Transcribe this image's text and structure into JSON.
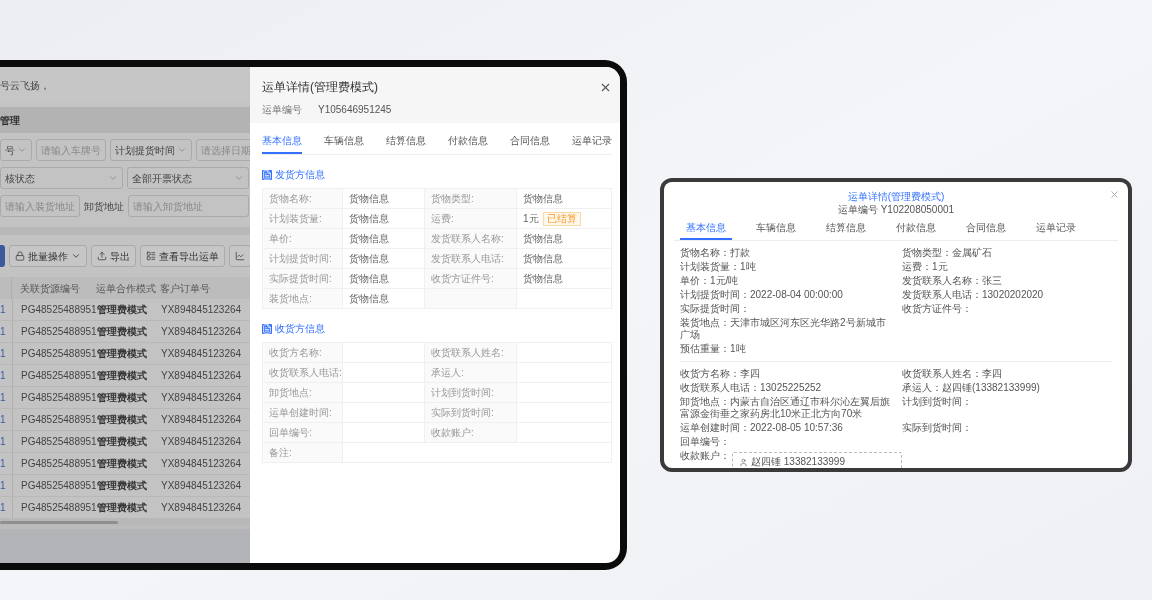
{
  "left_device": {
    "page": {
      "greeting": "号云飞扬，",
      "section_title": "管理",
      "filter_rows": [
        [
          {
            "kind": "select",
            "value": "号"
          },
          {
            "kind": "input",
            "placeholder": "请输入车牌号"
          },
          {
            "kind": "select",
            "value": "计划提货时间"
          },
          {
            "kind": "input",
            "placeholder": "请选择日期"
          }
        ],
        [
          {
            "kind": "select",
            "value": "核状态"
          },
          {
            "kind": "select",
            "value": "全部开票状态"
          }
        ],
        [
          {
            "kind": "input",
            "placeholder": "请输入装货地址"
          },
          {
            "kind": "label",
            "value": "卸货地址"
          },
          {
            "kind": "input",
            "placeholder": "请输入卸货地址"
          }
        ]
      ],
      "toolbar": [
        {
          "kind": "primary"
        },
        {
          "kind": "batch",
          "label": "批量操作"
        },
        {
          "kind": "export",
          "label": "导出"
        },
        {
          "kind": "list",
          "label": "查看导出运单"
        },
        {
          "kind": "chart"
        }
      ],
      "table": {
        "columns": [
          "关联货源编号",
          "运单合作模式",
          "客户订单号"
        ],
        "rows": [
          {
            "column_1": "1",
            "source_no": "PG48525488951",
            "mode": "管理费模式",
            "order_no": "YX894845123264"
          },
          {
            "column_1": "1",
            "source_no": "PG48525488951",
            "mode": "管理费模式",
            "order_no": "YX894845123264"
          },
          {
            "column_1": "1",
            "source_no": "PG48525488951",
            "mode": "管理费模式",
            "order_no": "YX894845123264"
          },
          {
            "column_1": "1",
            "source_no": "PG48525488951",
            "mode": "管理费模式",
            "order_no": "YX894845123264"
          },
          {
            "column_1": "1",
            "source_no": "PG48525488951",
            "mode": "管理费模式",
            "order_no": "YX894845123264"
          },
          {
            "column_1": "1",
            "source_no": "PG48525488951",
            "mode": "管理费模式",
            "order_no": "YX894845123264"
          },
          {
            "column_1": "1",
            "source_no": "PG48525488951",
            "mode": "管理费模式",
            "order_no": "YX894845123264"
          },
          {
            "column_1": "1",
            "source_no": "PG48525488951",
            "mode": "管理费模式",
            "order_no": "YX894845123264"
          },
          {
            "column_1": "1",
            "source_no": "PG48525488951",
            "mode": "管理费模式",
            "order_no": "YX894845123264"
          },
          {
            "column_1": "1",
            "source_no": "PG48525488951",
            "mode": "管理费模式",
            "order_no": "YX894845123264"
          }
        ]
      }
    },
    "modal": {
      "title": "运单详情(管理费模式)",
      "number_label": "运单编号",
      "number": "Y105646951245",
      "tabs": [
        {
          "label": "基本信息",
          "selected": true
        },
        {
          "label": "车辆信息",
          "selected": false
        },
        {
          "label": "结算信息",
          "selected": false
        },
        {
          "label": "付款信息",
          "selected": false
        },
        {
          "label": "合同信息",
          "selected": false
        },
        {
          "label": "运单记录",
          "selected": false
        }
      ],
      "sections": [
        {
          "title": "发货方信息",
          "rows": [
            [
              {
                "label": "货物名称:",
                "value": "货物信息"
              },
              {
                "label": "货物类型:",
                "value": "货物信息"
              }
            ],
            [
              {
                "label": "计划装货量:",
                "value": "货物信息"
              },
              {
                "label": "运费:",
                "value": "1元",
                "tag": "已结算"
              }
            ],
            [
              {
                "label": "单价:",
                "value": "货物信息"
              },
              {
                "label": "发货联系人名称:",
                "value": "货物信息"
              }
            ],
            [
              {
                "label": "计划提货时间:",
                "value": "货物信息"
              },
              {
                "label": "发货联系人电话:",
                "value": "货物信息"
              }
            ],
            [
              {
                "label": "实际提货时间:",
                "value": "货物信息"
              },
              {
                "label": "收货方证件号:",
                "value": "货物信息"
              }
            ],
            [
              {
                "label": "装货地点:",
                "value": "货物信息"
              }
            ]
          ]
        },
        {
          "title": "收货方信息",
          "rows": [
            [
              {
                "label": "收货方名称:"
              },
              {
                "label": "收货联系人姓名:"
              }
            ],
            [
              {
                "label": "收货联系人电话:"
              },
              {
                "label": "承运人:"
              }
            ],
            [
              {
                "label": "卸货地点:"
              },
              {
                "label": "计划到货时间:"
              }
            ],
            [
              {
                "label": "运单创建时间:"
              },
              {
                "label": "实际到货时间:"
              }
            ],
            [
              {
                "label": "回单编号:"
              },
              {
                "label": "收款账户:"
              }
            ],
            [
              {
                "label": "备注:",
                "kind": "wide"
              }
            ]
          ]
        }
      ]
    }
  },
  "right_device": {
    "modal": {
      "title": "运单详情(管理费模式)",
      "number_label": "运单编号",
      "number": "Y102208050001",
      "tabs": [
        {
          "label": "基本信息",
          "selected": true
        },
        {
          "label": "车辆信息",
          "selected": false
        },
        {
          "label": "结算信息",
          "selected": false
        },
        {
          "label": "付款信息",
          "selected": false
        },
        {
          "label": "合同信息",
          "selected": false
        },
        {
          "label": "运单记录",
          "selected": false
        }
      ],
      "groups": [
        {
          "rows": [
            [
              {
                "label": "货物名称：",
                "value": "打款"
              },
              {
                "label": "货物类型：",
                "value": "金属矿石"
              }
            ],
            [
              {
                "label": "计划装货量：",
                "value": "1吨"
              },
              {
                "label": "运费：",
                "value": "1元"
              }
            ],
            [
              {
                "label": "单价：",
                "value": "1元/吨"
              },
              {
                "label": "发货联系人名称：",
                "value": "张三"
              }
            ],
            [
              {
                "label": "计划提货时间：",
                "value": "2022-08-04 00:00:00"
              },
              {
                "label": "发货联系人电话：",
                "value": "13020202020"
              }
            ],
            [
              {
                "label": "实际提货时间："
              },
              {
                "label": "收货方证件号："
              }
            ],
            [
              {
                "label": "装货地点：",
                "value": "天津市城区河东区光华路2号新城市广场"
              }
            ],
            [
              {
                "label": "预估重量：",
                "value": "1吨"
              }
            ]
          ]
        },
        {
          "rows": [
            [
              {
                "label": "收货方名称：",
                "value": "李四"
              },
              {
                "label": "收货联系人姓名：",
                "value": "李四"
              }
            ],
            [
              {
                "label": "收货联系人电话：",
                "value": "13025225252"
              },
              {
                "label": "承运人：",
                "value": "赵四锤(13382133999)"
              }
            ],
            [
              {
                "label": "卸货地点：",
                "value": "内蒙古自治区通辽市科尔沁左翼后旗富源金街垂之家药房北10米正北方向70米"
              },
              {
                "label": "计划到货时间："
              }
            ],
            [
              {
                "label": "运单创建时间：",
                "value": "2022-08-05 10:57:36"
              },
              {
                "label": "实际到货时间："
              }
            ],
            [
              {
                "label": "回单编号："
              }
            ],
            [
              {
                "label": "收款账户：",
                "account": "赵四锤 13382133999"
              }
            ]
          ]
        }
      ]
    }
  }
}
